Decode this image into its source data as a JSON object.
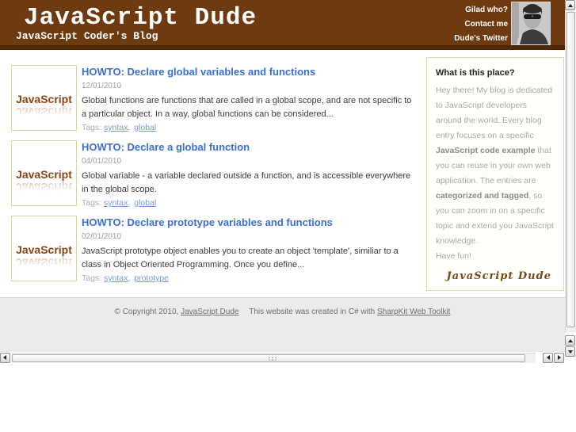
{
  "header": {
    "title": "JavaScript Dude",
    "subtitle": "JavaScript Coder's Blog",
    "links": [
      {
        "label": "Gilad who?"
      },
      {
        "label": "Contact me"
      },
      {
        "label": "Dude's Twitter"
      }
    ]
  },
  "posts": [
    {
      "title": "HOWTO: Declare global variables and functions",
      "date": "12/01/2010",
      "excerpt": "Global functions are functions that are called in a global scope, and are not specific to a particular object. In a way, global functions can be considered...",
      "tags_label": "Tags:",
      "tag_separator": ",",
      "tags": [
        "syntax",
        "global"
      ],
      "thumb_text": "JavaScript"
    },
    {
      "title": "HOWTO: Declare a global function",
      "date": "04/01/2010",
      "excerpt": "Global variable - a variable declared outside a function, and is accessible everywhere in the global scope.",
      "tags_label": "Tags:",
      "tag_separator": ",",
      "tags": [
        "syntax",
        "global"
      ],
      "thumb_text": "JavaScript"
    },
    {
      "title": "HOWTO: Declare prototype variables and functions",
      "date": "02/01/2010",
      "excerpt": "JavaScript prototype object enables you to create an object 'template', similiar to a class in Object Oriented Programming. Once you define...",
      "tags_label": "Tags:",
      "tag_separator": ",",
      "tags": [
        "syntax",
        "prototype"
      ],
      "thumb_text": "JavaScript"
    }
  ],
  "sidebar": {
    "title": "What is this place?",
    "p1": "Hey there! My blog is dedicated to JavaScript developers around the world. Every blog entry focuses on a specific ",
    "b1": "JavaScript code example",
    "p2": " that you can reuse in your own web application. The entries are ",
    "b2": "categorized and tagged",
    "p3": ", so you can zoom in on a specific topic and extend you JavaScript knowledge.",
    "p4": "Have fun!",
    "signature": "JavaScript Dude"
  },
  "footer": {
    "copyright_prefix": "© Copyright 2010,",
    "copyright_link": "JavaScript Dude",
    "created_text": "This website was created in C# with",
    "toolkit_link": "SharpKit Web Toolkit"
  },
  "colors": {
    "header_background": "#6E3B10",
    "header_strip": "#4E2904",
    "title_link": "#3B6FD4",
    "tag_link": "#7A98DB",
    "body_text": "#3C3C3C",
    "muted_text": "#9E9E9E",
    "box_border": "#DCDCB4",
    "thumb_border": "#D6D6AB",
    "thumb_text": "#8B4513",
    "signature": "#7A4A16",
    "footer_background": "#EBEBEB"
  }
}
